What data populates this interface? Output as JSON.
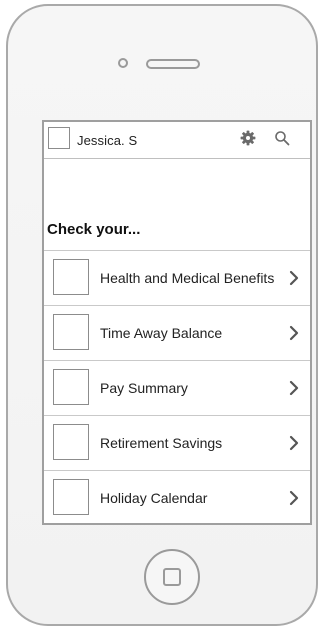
{
  "header": {
    "user_name": "Jessica. S",
    "settings_icon": "gear-icon",
    "search_icon": "search-icon"
  },
  "main": {
    "heading": "Check your...",
    "items": [
      {
        "label": "Health and Medical Benefits",
        "icon": "chevron-right-icon"
      },
      {
        "label": "Time Away Balance",
        "icon": "chevron-right-icon"
      },
      {
        "label": "Pay Summary",
        "icon": "chevron-right-icon"
      },
      {
        "label": "Retirement Savings",
        "icon": "chevron-right-icon"
      },
      {
        "label": "Holiday Calendar",
        "icon": "chevron-right-icon"
      }
    ]
  },
  "device": {
    "home_icon": "home-button-icon"
  }
}
